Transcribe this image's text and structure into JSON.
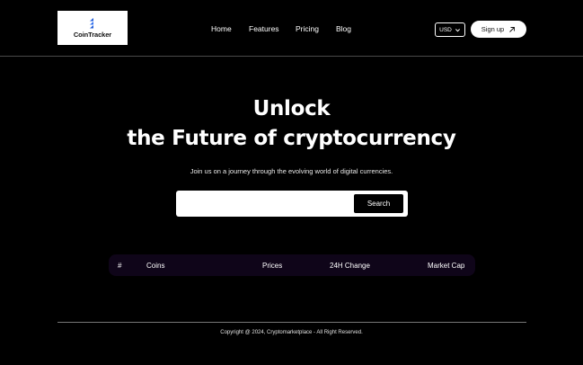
{
  "brand": {
    "name": "CoinTracker",
    "logo_icon": "cointracker-logo-icon",
    "accent_color": "#1e5bd8"
  },
  "nav": {
    "links": [
      "Home",
      "Features",
      "Pricing",
      "Blog"
    ],
    "currency": "USD",
    "signup_label": "Sign up"
  },
  "hero": {
    "title_line1": "Unlock",
    "title_line2": "the Future of cryptocurrency",
    "subtitle": "Join us on a journey through the evolving world of digital currencies."
  },
  "search": {
    "value": "",
    "button_label": "Search"
  },
  "table": {
    "columns": [
      "#",
      "Coins",
      "Prices",
      "24H Change",
      "Market Cap"
    ],
    "header_bg": "#0f0519"
  },
  "footer": {
    "copyright": "Copyright @ 2024, Cryptomarketplace - All Right Reserved."
  }
}
